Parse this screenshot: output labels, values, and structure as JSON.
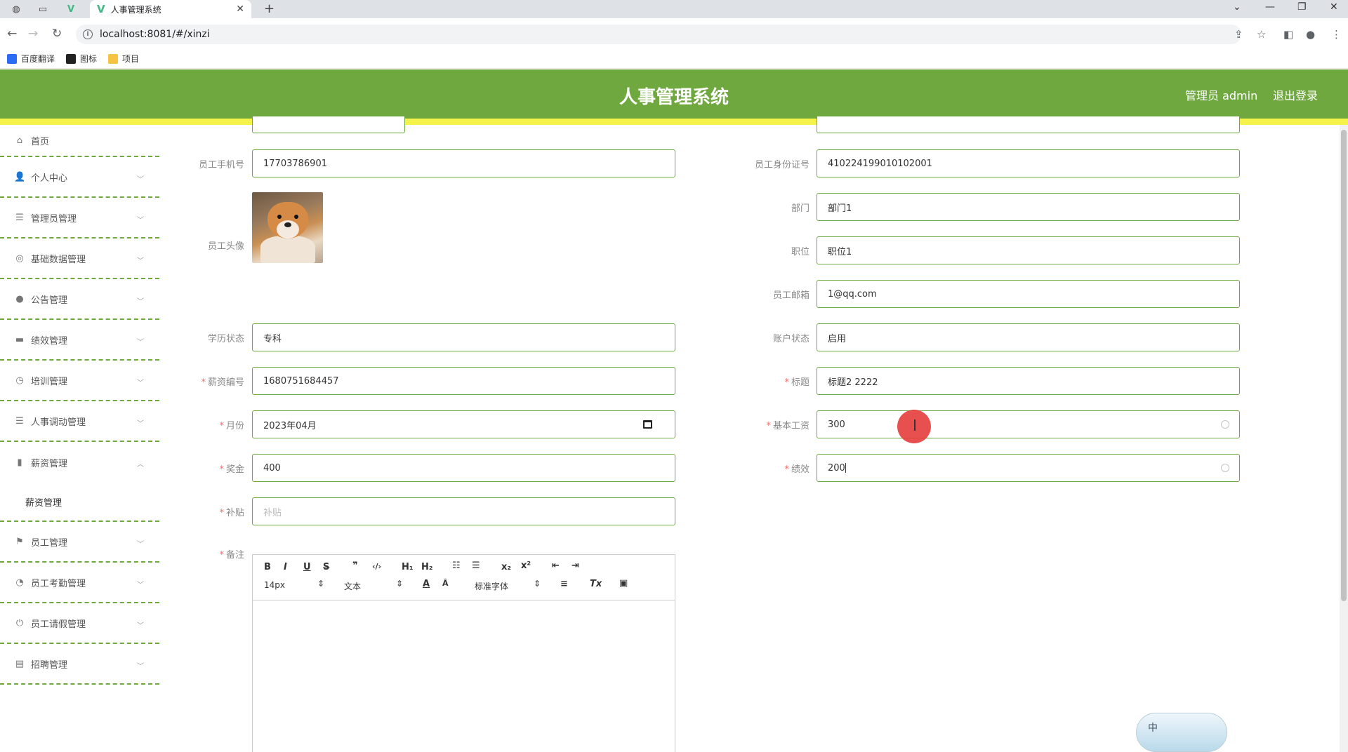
{
  "browser": {
    "tab_title": "人事管理系统",
    "url": "localhost:8081/#/xinzi",
    "bookmarks": [
      "百度翻译",
      "图标",
      "项目"
    ]
  },
  "header": {
    "title": "人事管理系统",
    "user": "管理员 admin",
    "logout": "退出登录"
  },
  "sidebar": {
    "items": [
      {
        "label": "首页",
        "icon": "home-icon"
      },
      {
        "label": "个人中心",
        "icon": "user-icon"
      },
      {
        "label": "管理员管理",
        "icon": "menu-icon"
      },
      {
        "label": "基础数据管理",
        "icon": "settings-icon"
      },
      {
        "label": "公告管理",
        "icon": "bulb-icon"
      },
      {
        "label": "绩效管理",
        "icon": "chat-icon"
      },
      {
        "label": "培训管理",
        "icon": "clock-icon"
      },
      {
        "label": "人事调动管理",
        "icon": "menu-icon"
      },
      {
        "label": "薪资管理",
        "icon": "chart-icon"
      },
      {
        "label": "员工管理",
        "icon": "flag-icon"
      },
      {
        "label": "员工考勤管理",
        "icon": "time-icon"
      },
      {
        "label": "员工请假管理",
        "icon": "power-icon"
      },
      {
        "label": "招聘管理",
        "icon": "card-icon"
      }
    ],
    "submenu": "薪资管理"
  },
  "form": {
    "phone": {
      "label": "员工手机号",
      "value": "17703786901"
    },
    "idcard": {
      "label": "员工身份证号",
      "value": "410224199010102001"
    },
    "avatar": {
      "label": "员工头像"
    },
    "dept": {
      "label": "部门",
      "value": "部门1"
    },
    "position": {
      "label": "职位",
      "value": "职位1"
    },
    "email": {
      "label": "员工邮箱",
      "value": "1@qq.com"
    },
    "education": {
      "label": "学历状态",
      "value": "专科"
    },
    "account": {
      "label": "账户状态",
      "value": "启用"
    },
    "salary_no": {
      "label": "薪资编号",
      "value": "1680751684457"
    },
    "title": {
      "label": "标题",
      "value": "标题2 2222"
    },
    "month": {
      "label": "月份",
      "value": "2023年04月"
    },
    "base_salary": {
      "label": "基本工资",
      "value": "300"
    },
    "bonus": {
      "label": "奖金",
      "value": "400"
    },
    "performance": {
      "label": "绩效",
      "value": "200"
    },
    "allowance": {
      "label": "补贴",
      "placeholder": "补贴"
    },
    "remark": {
      "label": "备注"
    }
  },
  "editor": {
    "font_size": "14px",
    "text_type": "文本",
    "font_family": "标准字体"
  },
  "ime": {
    "label": "中"
  },
  "colors": {
    "accent": "#6fa83f",
    "strip": "#f5f24a",
    "required": "#f56c6c"
  }
}
